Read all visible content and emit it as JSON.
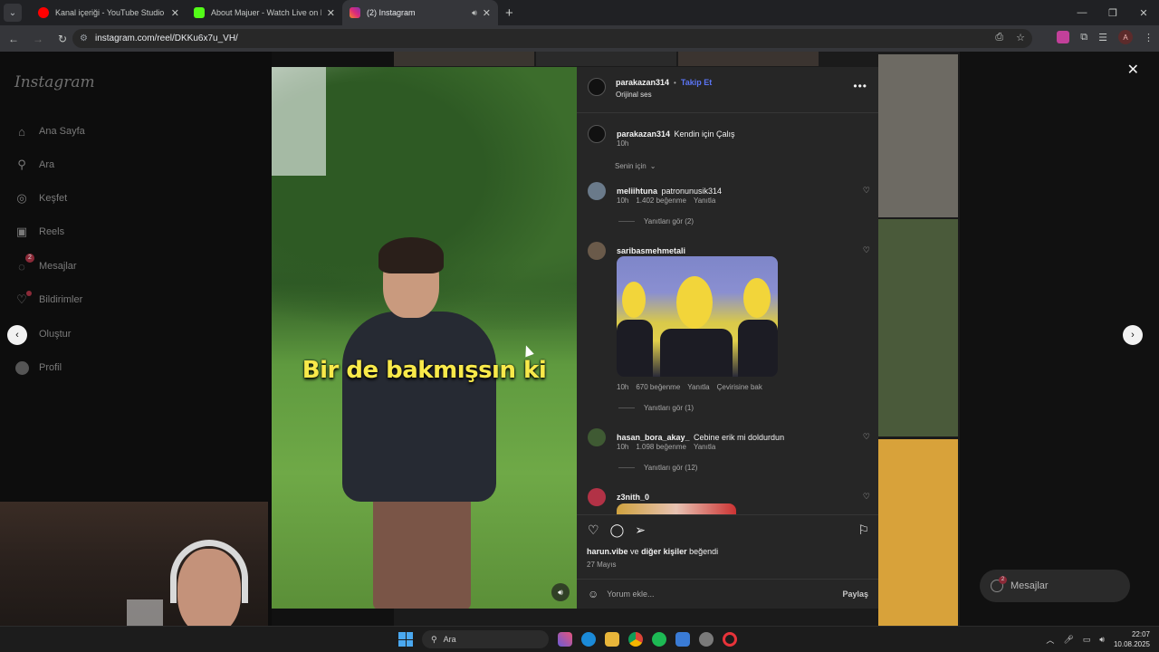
{
  "browser": {
    "tabs": [
      {
        "title": "Kanal içeriği - YouTube Studio",
        "favicon_color": "#ff0000",
        "active": false
      },
      {
        "title": "About Majuer - Watch Live on Kick",
        "favicon_color": "#53fc18",
        "active": false
      },
      {
        "title": "(2) Instagram",
        "favicon_color": "#e1306c",
        "active": true
      }
    ],
    "url": "instagram.com/reel/DKKu6x7u_VH/",
    "profile_initial": "A"
  },
  "instagram": {
    "logo": "Instagram",
    "nav": [
      {
        "label": "Ana Sayfa",
        "icon": "home-icon"
      },
      {
        "label": "Ara",
        "icon": "search-icon"
      },
      {
        "label": "Keşfet",
        "icon": "compass-icon"
      },
      {
        "label": "Reels",
        "icon": "reels-icon"
      },
      {
        "label": "Mesajlar",
        "icon": "messenger-icon",
        "badge": "2"
      },
      {
        "label": "Bildirimler",
        "icon": "heart-icon"
      },
      {
        "label": "Oluştur",
        "icon": "plus-icon"
      },
      {
        "label": "Profil",
        "icon": "profile-icon"
      }
    ],
    "reel": {
      "caption_overlay": "Bir de bakmışsın ki",
      "author": "parakazan314",
      "follow_label": "Takip Et",
      "audio": "Orijinal ses",
      "description": "Kendin için Çalış",
      "description_time": "10h",
      "sort_label": "Senin için",
      "liked_by_user": "harun.vibe",
      "liked_by_and": "ve",
      "liked_by_others": "diğer kişiler",
      "liked_by_suffix": "beğendi",
      "date": "27 Mayıs",
      "comment_placeholder": "Yorum ekle...",
      "share_label": "Paylaş"
    },
    "comments": [
      {
        "user": "meliihtuna",
        "text": "patronunusik314",
        "time": "10h",
        "likes": "1.402 beğenme",
        "reply": "Yanıtla",
        "view_replies": "Yanıtları gör (2)"
      },
      {
        "user": "saribasmehmetali",
        "text": "",
        "time": "10h",
        "likes": "670 beğenme",
        "reply": "Yanıtla",
        "translate": "Çevirisine bak",
        "view_replies": "Yanıtları gör (1)"
      },
      {
        "user": "hasan_bora_akay_",
        "text": "Cebine erik mi doldurdun",
        "time": "10h",
        "likes": "1.098 beğenme",
        "reply": "Yanıtla",
        "view_replies": "Yanıtları gör (12)"
      },
      {
        "user": "z3nith_0",
        "text": ""
      }
    ],
    "messages_pill": {
      "label": "Mesajlar",
      "badge": "2"
    }
  },
  "taskbar": {
    "search_label": "Ara",
    "time": "22:07",
    "date": "10.08.2025"
  }
}
